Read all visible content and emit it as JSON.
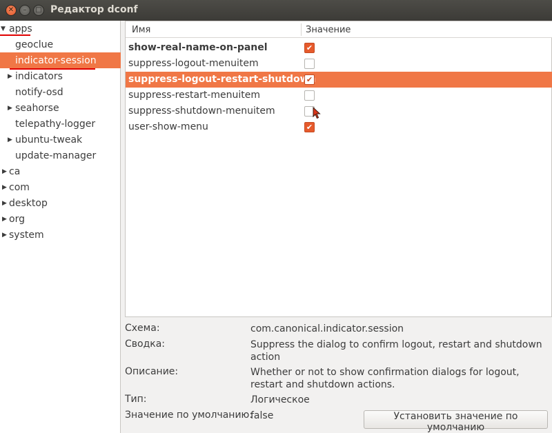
{
  "window": {
    "title": "Редактор dconf",
    "close_glyph": "✕",
    "min_glyph": "–",
    "max_glyph": "□"
  },
  "tree": {
    "items": [
      {
        "label": "apps",
        "expander": "▼"
      },
      {
        "label": "geoclue",
        "expander": ""
      },
      {
        "label": "indicator-session",
        "expander": "",
        "selected": true
      },
      {
        "label": "indicators",
        "expander": "▶"
      },
      {
        "label": "notify-osd",
        "expander": ""
      },
      {
        "label": "seahorse",
        "expander": "▶"
      },
      {
        "label": "telepathy-logger",
        "expander": ""
      },
      {
        "label": "ubuntu-tweak",
        "expander": "▶"
      },
      {
        "label": "update-manager",
        "expander": ""
      },
      {
        "label": "ca",
        "expander": "▶"
      },
      {
        "label": "com",
        "expander": "▶"
      },
      {
        "label": "desktop",
        "expander": "▶"
      },
      {
        "label": "org",
        "expander": "▶"
      },
      {
        "label": "system",
        "expander": "▶"
      }
    ]
  },
  "keys": {
    "headers": {
      "name": "Имя",
      "value": "Значение"
    },
    "rows": [
      {
        "name": "show-real-name-on-panel",
        "checked": true,
        "bold": true
      },
      {
        "name": "suppress-logout-menuitem",
        "checked": false
      },
      {
        "name": "suppress-logout-restart-shutdown",
        "checked": true,
        "selected": true
      },
      {
        "name": "suppress-restart-menuitem",
        "checked": false
      },
      {
        "name": "suppress-shutdown-menuitem",
        "checked": false
      },
      {
        "name": "user-show-menu",
        "checked": true
      }
    ],
    "check_glyph": "✔"
  },
  "details": {
    "schema_label": "Схема:",
    "schema_value": "com.canonical.indicator.session",
    "summary_label": "Сводка:",
    "summary_value": "Suppress the dialog to confirm logout, restart and shutdown action",
    "description_label": "Описание:",
    "description_value": "Whether or not to show confirmation dialogs for logout, restart and shutdown actions.",
    "type_label": "Тип:",
    "type_value": "Логическое",
    "default_label": "Значение по умолчанию:",
    "default_value": "false",
    "set_default_button": "Установить значение по умолчанию"
  },
  "colors": {
    "accent": "#f07746",
    "checkbox_on": "#e65a2c",
    "titlebar": "#3c3b37",
    "annotation": "#e00000"
  }
}
